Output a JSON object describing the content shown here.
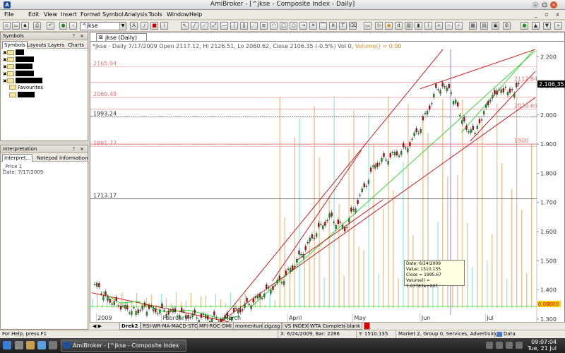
{
  "window": {
    "title": "AmiBroker - [^jkse - Composite Index - Daily]"
  },
  "menu": [
    "File",
    "Edit",
    "View",
    "Insert",
    "Format",
    "Symbol",
    "Analysis",
    "Tools",
    "Window",
    "Help"
  ],
  "toolbar": {
    "symbol": "^jkse"
  },
  "symbols_panel": {
    "title": "Symbols",
    "tabs": [
      "Symbols",
      "Layouts",
      "Layers",
      "Charts"
    ],
    "favourites": "Favourites"
  },
  "interpretation_panel": {
    "title": "Interpretation",
    "tabs": [
      "Interpret...",
      "Notepad",
      "Information"
    ],
    "lines": [
      "_Price 1",
      "Date: 7/17/2009"
    ]
  },
  "chart": {
    "tab_label": "jkse (Daily)",
    "info_line": "*jkse - Daily 7/17/2009 Open 2117.12, Hi 2126.51, Lo 2060.62, Close 2106.35 (-0.5%) Vol 0",
    "volume_text": "Volume() = 0.00",
    "level_labels": [
      {
        "text": "2165.94",
        "value": 2165.94
      },
      {
        "text": "2112.84",
        "value": 2112.84
      },
      {
        "text": "2060.48",
        "value": 2060.48
      },
      {
        "text": "2020.69",
        "value": 2020.69
      },
      {
        "text": "1993.24",
        "value": 1993.24
      },
      {
        "text": "1900",
        "value": 1900
      },
      {
        "text": "1891.77",
        "value": 1891.77
      },
      {
        "text": "1713.17",
        "value": 1713.17
      }
    ],
    "price_axis": [
      "2.200",
      "2.100",
      "2.000",
      "1.900",
      "1.800",
      "1.700",
      "1.600",
      "1.500",
      "1.400",
      "1.300"
    ],
    "last_price": "2.106,35",
    "volume_axis_label": "0.00000",
    "month_labels": [
      "2009",
      "February",
      "March",
      "April",
      "May",
      "Jun",
      "Jul"
    ],
    "tooltip": {
      "date": "Date: 6/24/2009",
      "value": "Value: 1510.135",
      "close": "Close = 1995.67",
      "volume": "Volume() = 7.07787e+007"
    }
  },
  "chart_data": {
    "type": "candlestick",
    "ylim": [
      1290,
      2225
    ],
    "price_series": [
      {
        "x": "2009-01-02",
        "y": 1420
      },
      {
        "x": "2009-01-08",
        "y": 1372
      },
      {
        "x": "2009-01-14",
        "y": 1340
      },
      {
        "x": "2009-01-20",
        "y": 1330
      },
      {
        "x": "2009-01-26",
        "y": 1336
      },
      {
        "x": "2009-02-02",
        "y": 1328
      },
      {
        "x": "2009-02-09",
        "y": 1322
      },
      {
        "x": "2009-02-16",
        "y": 1310
      },
      {
        "x": "2009-02-23",
        "y": 1305
      },
      {
        "x": "2009-03-02",
        "y": 1296
      },
      {
        "x": "2009-03-09",
        "y": 1330
      },
      {
        "x": "2009-03-16",
        "y": 1362
      },
      {
        "x": "2009-03-23",
        "y": 1400
      },
      {
        "x": "2009-03-30",
        "y": 1440
      },
      {
        "x": "2009-04-06",
        "y": 1510
      },
      {
        "x": "2009-04-13",
        "y": 1590
      },
      {
        "x": "2009-04-20",
        "y": 1650
      },
      {
        "x": "2009-04-27",
        "y": 1610
      },
      {
        "x": "2009-05-04",
        "y": 1720
      },
      {
        "x": "2009-05-11",
        "y": 1830
      },
      {
        "x": "2009-05-18",
        "y": 1858
      },
      {
        "x": "2009-05-25",
        "y": 1882
      },
      {
        "x": "2009-06-01",
        "y": 1960
      },
      {
        "x": "2009-06-08",
        "y": 2082
      },
      {
        "x": "2009-06-12",
        "y": 2110
      },
      {
        "x": "2009-06-17",
        "y": 2040
      },
      {
        "x": "2009-06-22",
        "y": 1960
      },
      {
        "x": "2009-06-26",
        "y": 1930
      },
      {
        "x": "2009-07-01",
        "y": 2040
      },
      {
        "x": "2009-07-06",
        "y": 2070
      },
      {
        "x": "2009-07-10",
        "y": 2092
      },
      {
        "x": "2009-07-14",
        "y": 2080
      },
      {
        "x": "2009-07-17",
        "y": 2106.35
      }
    ],
    "x_range": [
      "2009-01-01",
      "2009-07-24"
    ]
  },
  "sheet_tabs": [
    "Drek2",
    "RSI-WR-MA-MACD-STO",
    "MFI-ROC-DMI",
    "momentum",
    "zigzag",
    "VS INDEX",
    "WTA Complete",
    "blank"
  ],
  "statusbar": {
    "help": "For Help, press F1",
    "coords": "X: 6/24/2009, Bar: 2286",
    "y_value": "Y: 1510.135",
    "market": "Market 2, Group 0, Services, Advertising",
    "data": "Data"
  },
  "taskbar": {
    "task": "AmiBroker - [^jkse - Composite Index",
    "time": "09:07:04",
    "date": "Tue, 21 Jul"
  },
  "colors": {
    "red": "#e00000",
    "green": "#22dd22",
    "candle_up": "#1a9a1a",
    "candle_down": "#cc0000",
    "volume_orange": "#f0b070",
    "volume_cyan": "#80e8d8"
  }
}
